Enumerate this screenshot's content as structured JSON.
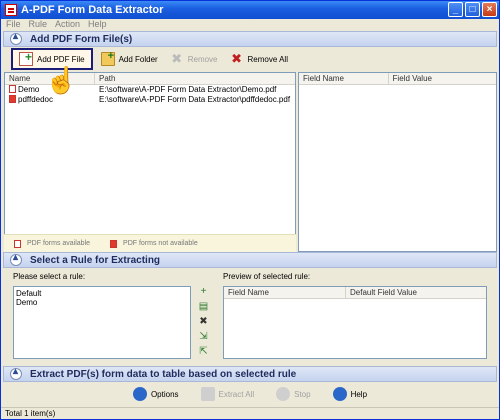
{
  "window": {
    "title": "A-PDF Form Data Extractor",
    "buttons": [
      "_",
      "□",
      "×"
    ]
  },
  "menu": [
    "File",
    "Rule",
    "Action",
    "Help"
  ],
  "sections": {
    "add": "Add PDF Form File(s)",
    "rule": "Select a Rule for Extracting",
    "extract": "Extract PDF(s) form data to table based on selected rule"
  },
  "toolbar": {
    "add_pdf": "Add PDF File",
    "add_folder": "Add Folder",
    "remove": "Remove",
    "remove_all": "Remove All"
  },
  "files": {
    "columns": [
      "Name",
      "Path"
    ],
    "rows": [
      {
        "name": "Demo",
        "path": "E:\\software\\A-PDF Form Data Extractor\\Demo.pdf"
      },
      {
        "name": "pdffdedoc",
        "path": "E:\\software\\A-PDF Form Data Extractor\\pdffdedoc.pdf"
      }
    ]
  },
  "fields": {
    "columns": [
      "Field Name",
      "Field Value"
    ]
  },
  "legend": {
    "available": "PDF forms available",
    "not_available": "PDF forms not available"
  },
  "rules": {
    "label": "Please select a rule:",
    "items": [
      "Default",
      "Demo"
    ],
    "preview_label": "Preview of selected rule:",
    "preview_columns": [
      "Field Name",
      "Default Field Value"
    ]
  },
  "bottom": {
    "options": "Options",
    "extract_all": "Extract All",
    "stop": "Stop",
    "help": "Help"
  },
  "status": "Total 1 item(s)"
}
